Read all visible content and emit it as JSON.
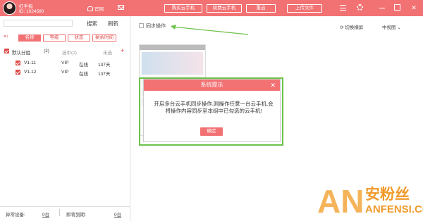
{
  "app": {
    "name": "红手指",
    "id": "ID: 1024580",
    "official_site": "官网"
  },
  "toolbar": {
    "buttons": [
      "购买云手机",
      "续费云手机",
      "重启",
      "上传文件"
    ],
    "window_minimize": "—",
    "window_maximize": "□",
    "window_close": "✕"
  },
  "left": {
    "search_placeholder": "",
    "search_label": "搜索",
    "refresh_label": "刷新",
    "sort_icon": "≡↑",
    "column_tabs": [
      "名称",
      "等级",
      "状态",
      "剩余时间"
    ],
    "group": {
      "name": "默认分组",
      "count": "(2)",
      "selected": "选中(2)",
      "expired": "未选",
      "add": "+"
    },
    "devices": [
      {
        "name": "V1-11",
        "level": "VIP",
        "status": "在线",
        "remaining": "137天"
      },
      {
        "name": "V1-12",
        "level": "VIP",
        "status": "在线",
        "remaining": "137天"
      }
    ],
    "footer": {
      "abnormal_label": "异常设备:",
      "abnormal_value": "0台",
      "expiring_label": "即将到期:",
      "expiring_value": "0台"
    }
  },
  "right": {
    "sync_label": "同步操作",
    "view_switch": "切换横屏",
    "size_select": "中视图"
  },
  "dialog": {
    "title": "系统提示",
    "message": "开启多台云手机同步操作,则操作任意一台云手机,会将操作内容同步至本组中已勾选的云手机!",
    "ok_label": "确定",
    "close": "✕"
  },
  "watermark": {
    "an": "AN",
    "cn": "安粉丝",
    "en": "ANFENSI.COM"
  },
  "colors": {
    "accent": "#f27274",
    "highlight": "#6cc24a",
    "watermark": "#f09a2a"
  }
}
